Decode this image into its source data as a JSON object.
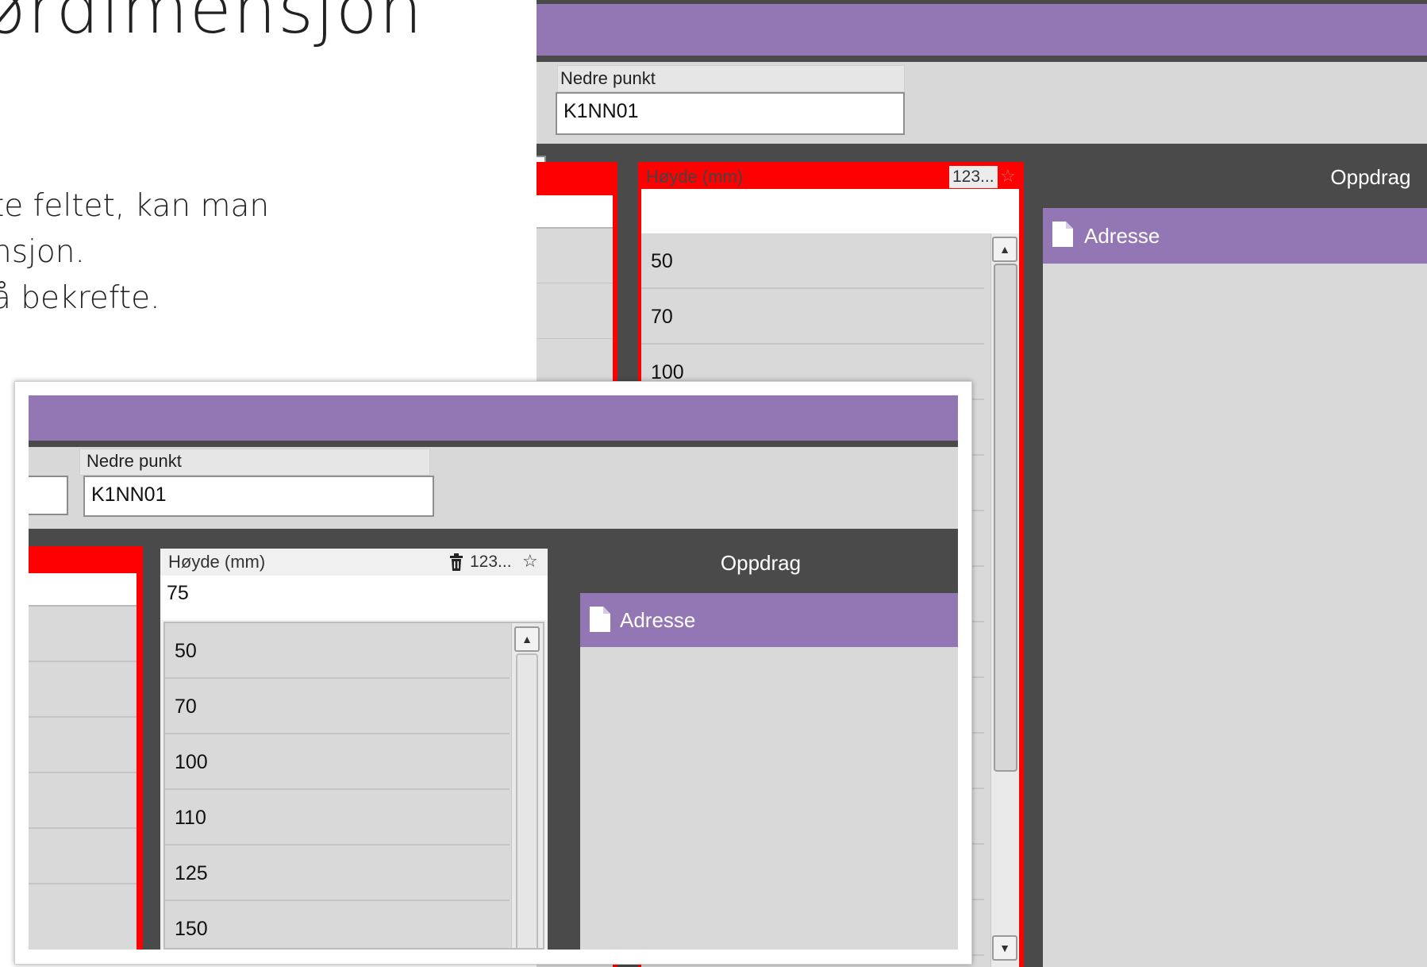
{
  "slide": {
    "title_fragment": "ørdimensjon",
    "bullets": [
      "te feltet, kan man",
      "nsjon.",
      "å bekrefte."
    ]
  },
  "back_window": {
    "nedre_punkt_label": "Nedre punkt",
    "nedre_punkt_value": "K1NN01",
    "height_column_label": "Høyde (mm)",
    "height_input_value": "",
    "count_chip": "123...",
    "list_values": [
      "50",
      "70",
      "100"
    ],
    "oppdrag_title": "Oppdrag",
    "oppdrag_item": "Adresse"
  },
  "front_window": {
    "nedre_punkt_label": "Nedre punkt",
    "nedre_punkt_value": "K1NN01",
    "height_column_label": "Høyde (mm)",
    "height_input_value": "75",
    "count_chip": "123...",
    "list_values": [
      "50",
      "70",
      "100",
      "110",
      "125",
      "150"
    ],
    "oppdrag_title": "Oppdrag",
    "oppdrag_item": "Adresse"
  },
  "icons": {
    "star": "star-outline-icon",
    "trash": "trash-icon",
    "document": "document-icon",
    "scroll_up": "scroll-up-icon",
    "scroll_down": "scroll-down-icon"
  },
  "colors": {
    "accent_purple": "#9376b4",
    "header_dark": "#4a4a4a",
    "required_red": "#ff0000",
    "panel_grey": "#d9d9d9"
  }
}
